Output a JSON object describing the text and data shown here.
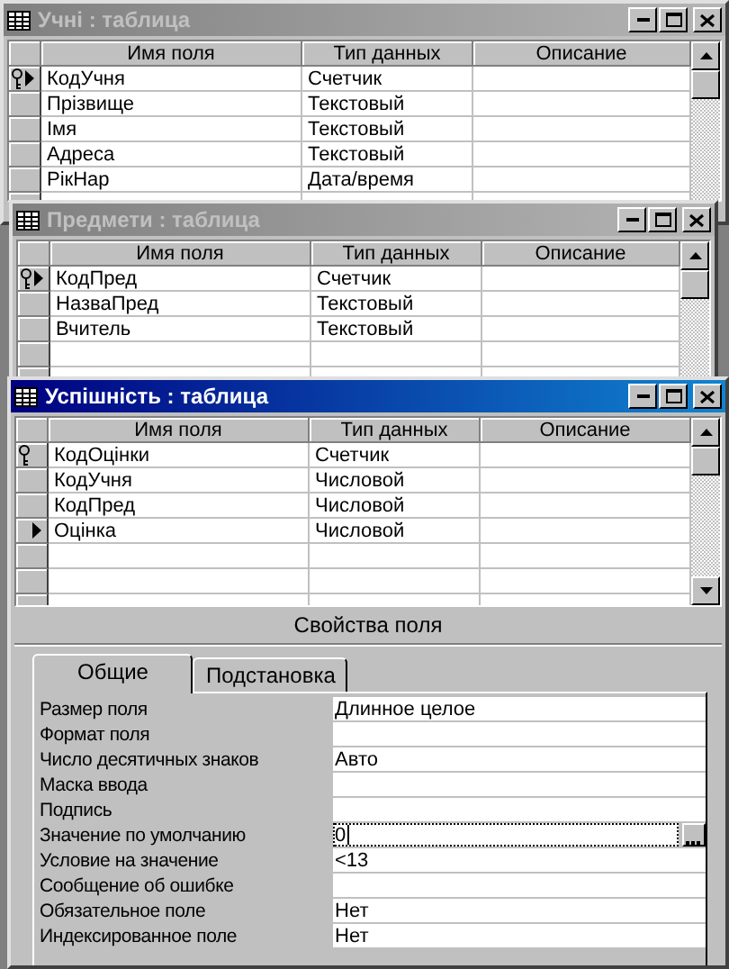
{
  "windows": [
    {
      "title": "Учні : таблица",
      "active": false,
      "columns": [
        "Имя поля",
        "Тип данных",
        "Описание"
      ],
      "rows": [
        {
          "name": "КодУчня",
          "type": "Счетчик",
          "key": true,
          "current": true
        },
        {
          "name": "Прізвище",
          "type": "Текстовый",
          "key": false,
          "current": false
        },
        {
          "name": "Імя",
          "type": "Текстовый",
          "key": false,
          "current": false
        },
        {
          "name": "Адреса",
          "type": "Текстовый",
          "key": false,
          "current": false
        },
        {
          "name": "РікНар",
          "type": "Дата/время",
          "key": false,
          "current": false
        }
      ]
    },
    {
      "title": "Предмети : таблица",
      "active": false,
      "columns": [
        "Имя поля",
        "Тип данных",
        "Описание"
      ],
      "rows": [
        {
          "name": "КодПред",
          "type": "Счетчик",
          "key": true,
          "current": true
        },
        {
          "name": "НазваПред",
          "type": "Текстовый",
          "key": false,
          "current": false
        },
        {
          "name": "Вчитель",
          "type": "Текстовый",
          "key": false,
          "current": false
        }
      ]
    },
    {
      "title": "Успішність : таблица",
      "active": true,
      "columns": [
        "Имя поля",
        "Тип данных",
        "Описание"
      ],
      "rows": [
        {
          "name": "КодОцінки",
          "type": "Счетчик",
          "key": true,
          "current": false
        },
        {
          "name": "КодУчня",
          "type": "Числовой",
          "key": false,
          "current": false
        },
        {
          "name": "КодПред",
          "type": "Числовой",
          "key": false,
          "current": false
        },
        {
          "name": "Оцінка",
          "type": "Числовой",
          "key": false,
          "current": true
        }
      ],
      "field_properties": {
        "caption": "Свойства поля",
        "tabs": [
          {
            "label": "Общие",
            "selected": true
          },
          {
            "label": "Подстановка",
            "selected": false
          }
        ],
        "properties": [
          {
            "label": "Размер поля",
            "value": "Длинное целое",
            "focused": false
          },
          {
            "label": "Формат поля",
            "focused": false
          },
          {
            "label": "Число десятичных знаков",
            "value": "Авто",
            "focused": false
          },
          {
            "label": "Маска ввода",
            "focused": false
          },
          {
            "label": "Подпись",
            "focused": false
          },
          {
            "label": "Значение по умолчанию",
            "value": "0",
            "focused": true
          },
          {
            "label": "Условие на значение",
            "value": "<13",
            "focused": false
          },
          {
            "label": "Сообщение об ошибке",
            "focused": false
          },
          {
            "label": "Обязательное поле",
            "value": "Нет",
            "focused": false
          },
          {
            "label": "Индексированное поле",
            "value": "Нет",
            "focused": false
          }
        ]
      }
    }
  ]
}
